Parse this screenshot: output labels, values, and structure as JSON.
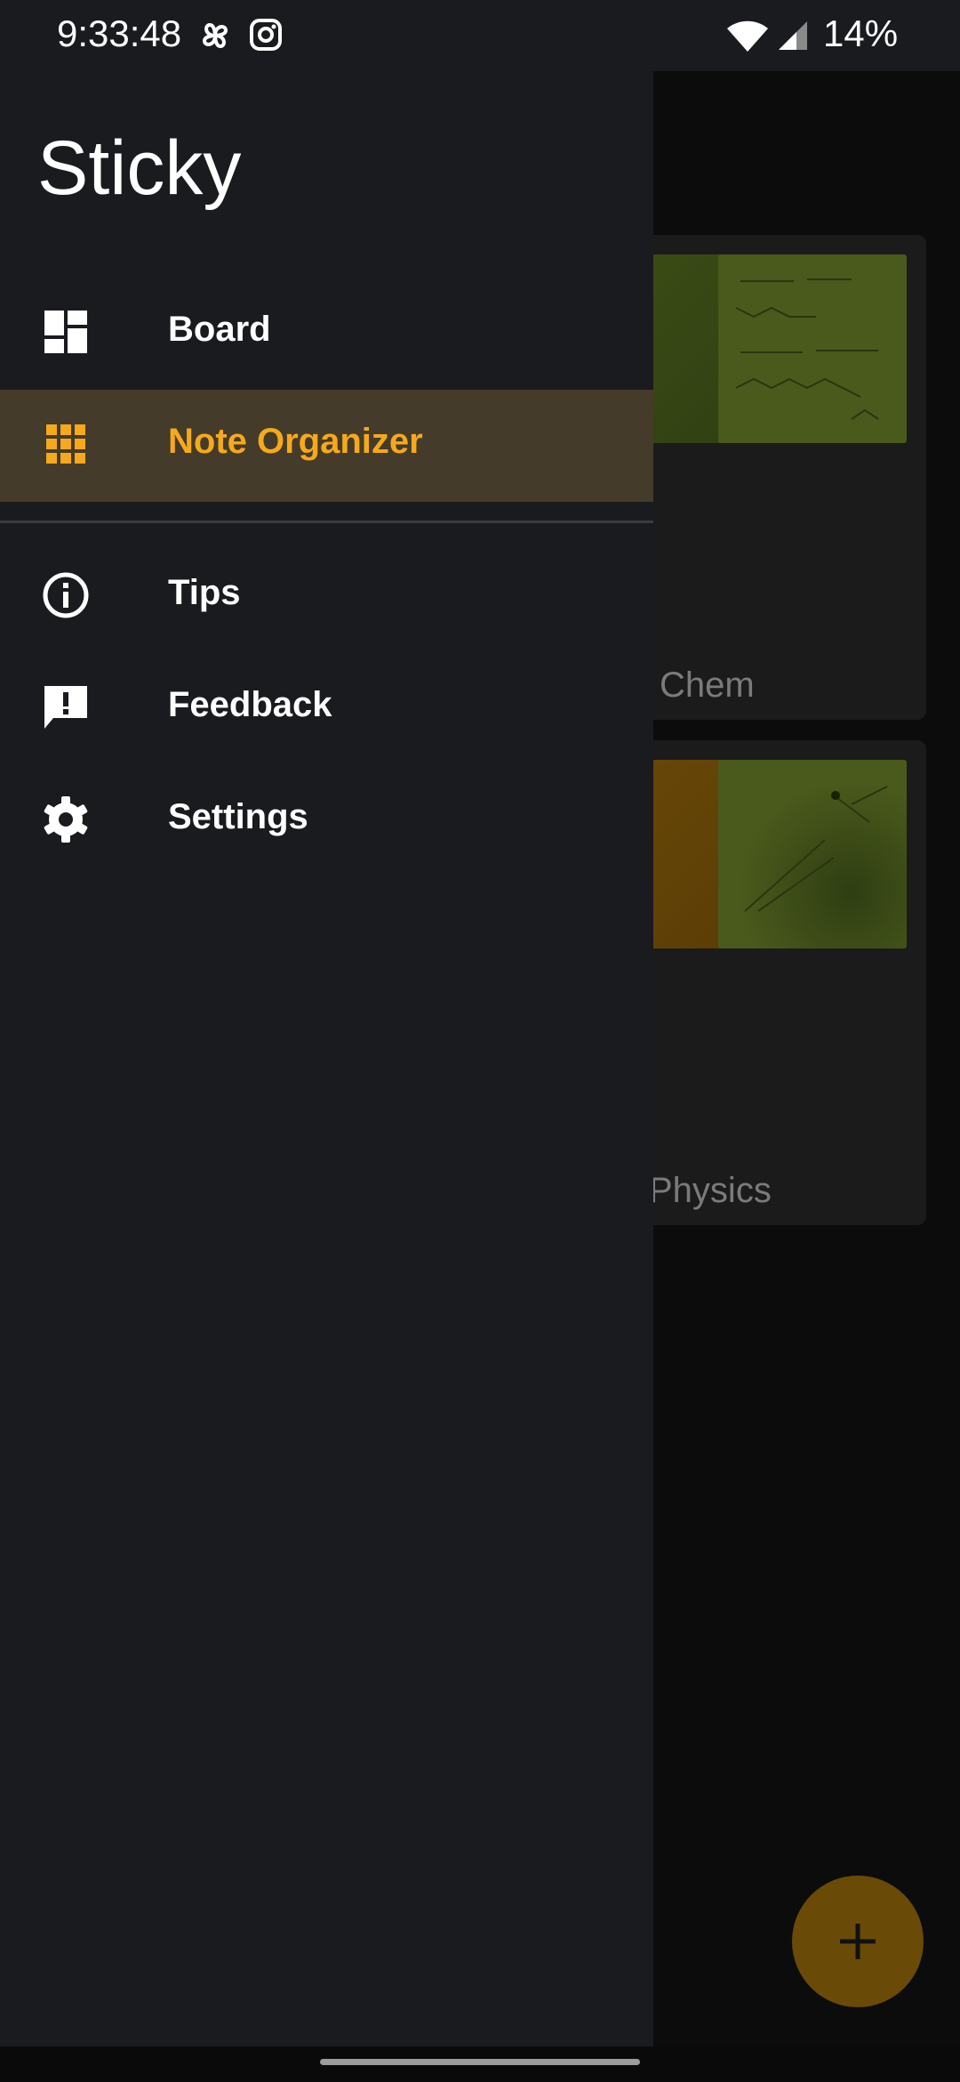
{
  "status_bar": {
    "time": "9:33:48",
    "battery": "14%",
    "icons": [
      "pinwheel-icon",
      "instagram-icon",
      "wifi-icon",
      "signal-icon"
    ]
  },
  "drawer": {
    "title": "Sticky",
    "items": [
      {
        "label": "Board",
        "icon": "dashboard-icon",
        "active": false
      },
      {
        "label": "Note Organizer",
        "icon": "grid-icon",
        "active": true
      },
      {
        "label": "Tips",
        "icon": "info-icon",
        "active": false
      },
      {
        "label": "Feedback",
        "icon": "feedback-icon",
        "active": false
      },
      {
        "label": "Settings",
        "icon": "gear-icon",
        "active": false
      }
    ]
  },
  "background": {
    "folders": [
      {
        "label": "Chem"
      },
      {
        "label": "Physics"
      }
    ],
    "fab_icon": "plus-icon"
  },
  "colors": {
    "accent": "#f5a91b",
    "drawer_bg": "#1a1b1f",
    "active_bg": "#453b2a"
  }
}
